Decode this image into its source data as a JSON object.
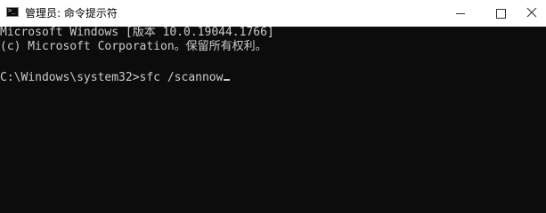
{
  "window": {
    "title": "管理员: 命令提示符",
    "icon": "terminal-icon",
    "icon_prompt": ">_"
  },
  "console": {
    "lines": [
      "Microsoft Windows [版本 10.0.19044.1766]",
      "(c) Microsoft Corporation。保留所有权利。",
      "",
      "C:\\Windows\\system32>sfc /scannow"
    ]
  },
  "colors": {
    "background": "#0c0c0c",
    "foreground": "#cccccc",
    "titlebar": "#ffffff"
  }
}
